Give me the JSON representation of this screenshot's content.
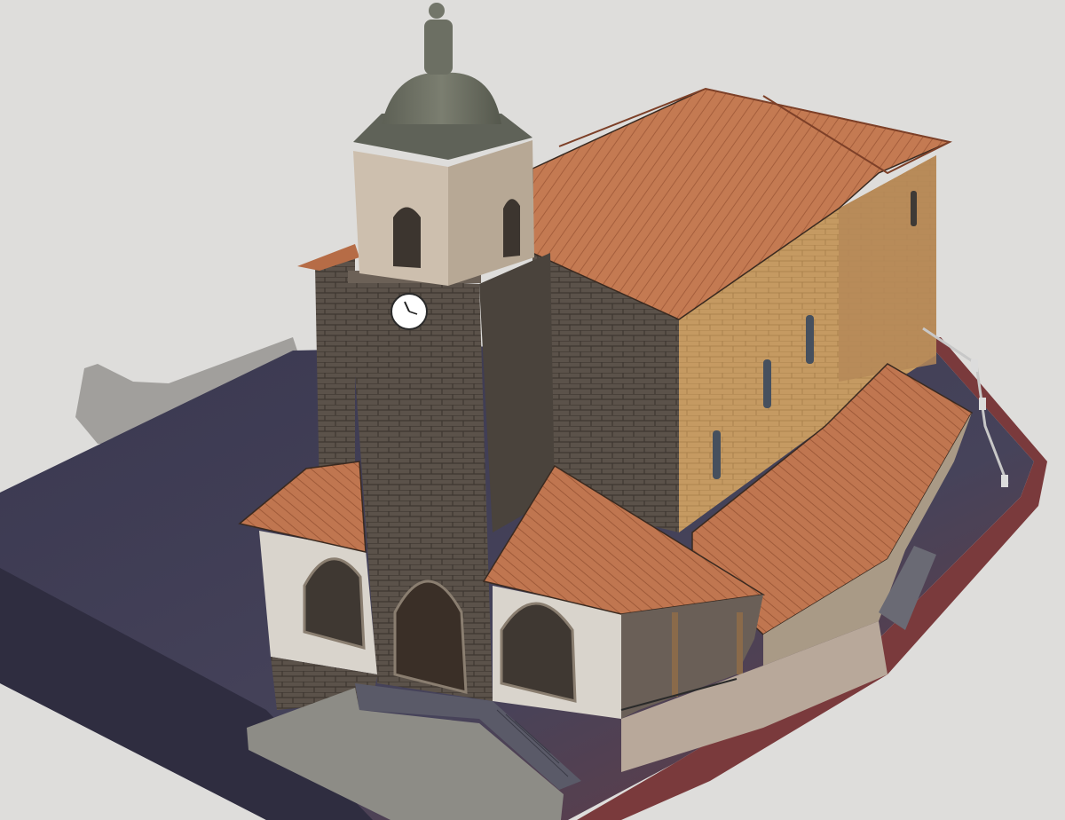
{
  "scene": {
    "subject": "",
    "colors": {
      "background": "#dedddb",
      "shadow": "#9c9b99",
      "ground_dark": "#3d3a4f",
      "ground_red": "#7a3a3c",
      "roof": "#c47a52",
      "roof_dark": "#a55e3c",
      "stone_dark": "#5b524a",
      "stone_light": "#cdbfae",
      "ochre_wall": "#c59a62",
      "plaster": "#d9d4cc",
      "dome": "#6f7265",
      "clock_face": "#ffffff"
    }
  }
}
